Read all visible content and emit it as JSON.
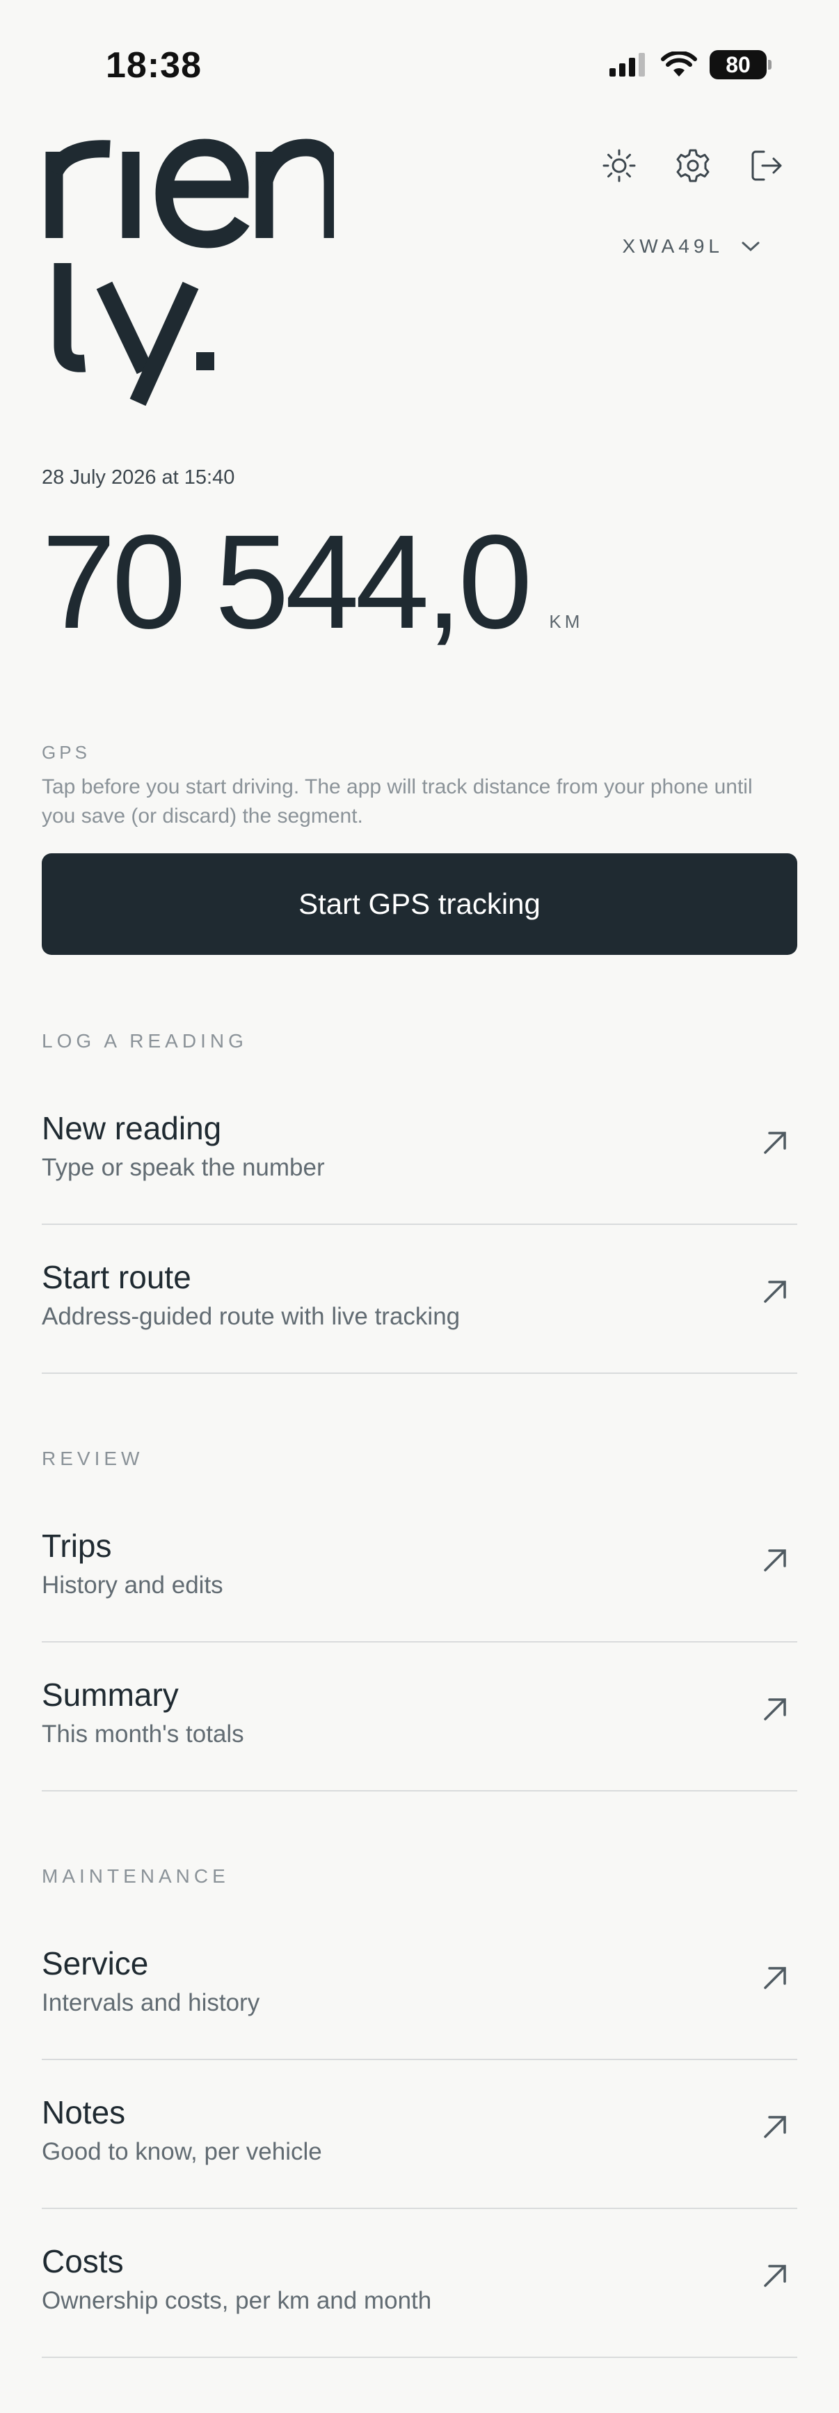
{
  "status_bar": {
    "time": "18:38",
    "battery": "80"
  },
  "app": {
    "logo": "rienly."
  },
  "header": {
    "icons": [
      "sun-icon",
      "settings-gear-icon",
      "logout-icon"
    ],
    "vehicle": "XWA49L"
  },
  "reading": {
    "timestamp": "28 July 2026 at 15:40",
    "odometer": "70 544,0",
    "unit": "KM"
  },
  "gps": {
    "label": "GPS",
    "description": "Tap before you start driving. The app will track distance from your phone until you save (or discard) the segment.",
    "button": "Start GPS tracking"
  },
  "sections": {
    "log": {
      "label": "LOG A READING",
      "items": [
        {
          "title": "New reading",
          "subtitle": "Type or speak the number"
        },
        {
          "title": "Start route",
          "subtitle": "Address-guided route with live tracking"
        }
      ]
    },
    "review": {
      "label": "REVIEW",
      "items": [
        {
          "title": "Trips",
          "subtitle": "History and edits"
        },
        {
          "title": "Summary",
          "subtitle": "This month's totals"
        }
      ]
    },
    "maintenance": {
      "label": "MAINTENANCE",
      "items": [
        {
          "title": "Service",
          "subtitle": "Intervals and history"
        },
        {
          "title": "Notes",
          "subtitle": "Good to know, per vehicle"
        },
        {
          "title": "Costs",
          "subtitle": "Ownership costs, per km and month"
        }
      ]
    }
  },
  "colors": {
    "primary": "#1f2a31",
    "background": "#f8f8f6",
    "muted": "#8a9298"
  }
}
